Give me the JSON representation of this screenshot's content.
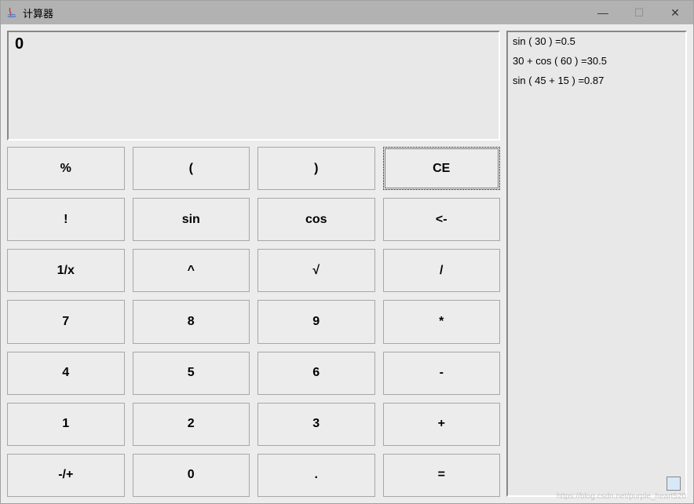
{
  "window": {
    "title": "计算器",
    "controls": {
      "minimize": "—",
      "maximize": "☐",
      "close": "✕"
    }
  },
  "display": {
    "value": "0"
  },
  "buttons": [
    {
      "id": "percent",
      "label": "%"
    },
    {
      "id": "lparen",
      "label": "("
    },
    {
      "id": "rparen",
      "label": ")"
    },
    {
      "id": "ce",
      "label": "CE",
      "focus": true
    },
    {
      "id": "factorial",
      "label": "!"
    },
    {
      "id": "sin",
      "label": "sin"
    },
    {
      "id": "cos",
      "label": "cos"
    },
    {
      "id": "backspace",
      "label": "<-"
    },
    {
      "id": "reciprocal",
      "label": "1/x"
    },
    {
      "id": "power",
      "label": "^"
    },
    {
      "id": "sqrt",
      "label": "√"
    },
    {
      "id": "divide",
      "label": "/"
    },
    {
      "id": "d7",
      "label": "7"
    },
    {
      "id": "d8",
      "label": "8"
    },
    {
      "id": "d9",
      "label": "9"
    },
    {
      "id": "multiply",
      "label": "*"
    },
    {
      "id": "d4",
      "label": "4"
    },
    {
      "id": "d5",
      "label": "5"
    },
    {
      "id": "d6",
      "label": "6"
    },
    {
      "id": "minus",
      "label": "-"
    },
    {
      "id": "d1",
      "label": "1"
    },
    {
      "id": "d2",
      "label": "2"
    },
    {
      "id": "d3",
      "label": "3"
    },
    {
      "id": "plus",
      "label": "+"
    },
    {
      "id": "negate",
      "label": "-/+"
    },
    {
      "id": "d0",
      "label": "0"
    },
    {
      "id": "decimal",
      "label": "."
    },
    {
      "id": "equals",
      "label": "="
    }
  ],
  "history": [
    "sin ( 30 ) =0.5",
    "30 + cos ( 60 ) =30.5",
    " sin ( 45 + 15 ) =0.87"
  ],
  "watermark": "https://blog.csdn.net/purple_heart520"
}
